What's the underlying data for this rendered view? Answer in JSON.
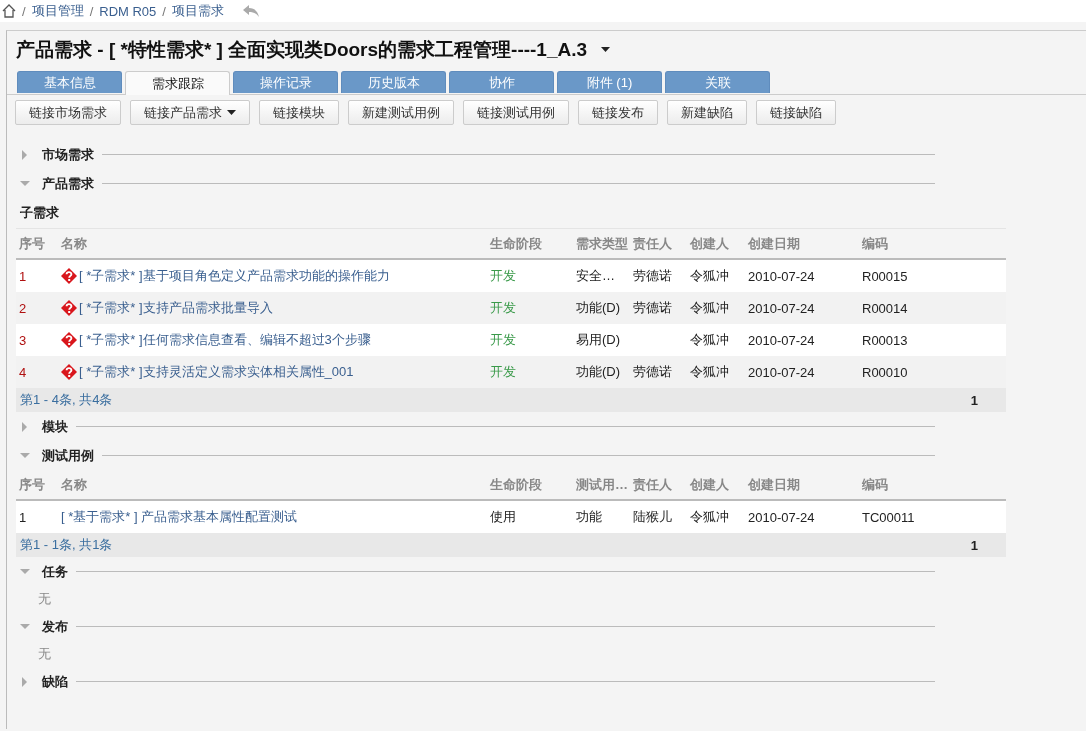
{
  "breadcrumb": {
    "separator": "/",
    "items": [
      "项目管理",
      "RDM R05",
      "项目需求"
    ]
  },
  "title": "产品需求 - [ *特性需求* ] 全面实现类Doors的需求工程管理----1_A.3",
  "tabs": [
    {
      "label": "基本信息",
      "selected": false
    },
    {
      "label": "需求跟踪",
      "selected": true
    },
    {
      "label": "操作记录",
      "selected": false
    },
    {
      "label": "历史版本",
      "selected": false
    },
    {
      "label": "协作",
      "selected": false
    },
    {
      "label": "附件 (1)",
      "selected": false
    },
    {
      "label": "关联",
      "selected": false
    }
  ],
  "buttons": [
    {
      "label": "链接市场需求",
      "kind": "plain"
    },
    {
      "label": "链接产品需求",
      "kind": "dropdown"
    },
    {
      "label": "链接模块",
      "kind": "plain"
    },
    {
      "label": "新建测试用例",
      "kind": "plain"
    },
    {
      "label": "链接测试用例",
      "kind": "plain"
    },
    {
      "label": "链接发布",
      "kind": "plain"
    },
    {
      "label": "新建缺陷",
      "kind": "plain"
    },
    {
      "label": "链接缺陷",
      "kind": "plain"
    }
  ],
  "sections": [
    {
      "title": "市场需求",
      "expanded": false
    },
    {
      "title": "产品需求",
      "expanded": true,
      "subtitle": "子需求",
      "table": {
        "columns": [
          "序号",
          "名称",
          "生命阶段",
          "需求类型",
          "责任人",
          "创建人",
          "创建日期",
          "编码"
        ],
        "rows": [
          {
            "kind": "requirement",
            "color": "#3a9a4a",
            "cells": [
              "1",
              "[ *子需求* ]基于项目角色定义产品需求功能的操作能力",
              "开发",
              "安全…",
              "劳德诺",
              "令狐冲",
              "2010-07-24",
              "R00015"
            ]
          },
          {
            "kind": "requirement",
            "color": "#3a9a4a",
            "cells": [
              "2",
              "[ *子需求* ]支持产品需求批量导入",
              "开发",
              "功能(D)",
              "劳德诺",
              "令狐冲",
              "2010-07-24",
              "R00014"
            ]
          },
          {
            "kind": "requirement",
            "color": "#3a9a4a",
            "cells": [
              "3",
              "[ *子需求* ]任何需求信息查看、编辑不超过3个步骤",
              "开发",
              "易用(D)",
              "",
              "令狐冲",
              "2010-07-24",
              "R00013"
            ]
          },
          {
            "kind": "requirement",
            "color": "#3a9a4a",
            "cells": [
              "4",
              "[ *子需求* ]支持灵活定义需求实体相关属性_001",
              "开发",
              "功能(D)",
              "劳德诺",
              "令狐冲",
              "2010-07-24",
              "R00010"
            ]
          }
        ],
        "pager": "第1 - 4条, 共4条",
        "page": "1"
      }
    },
    {
      "title": "模块",
      "expanded": false
    },
    {
      "title": "测试用例",
      "expanded": true,
      "table": {
        "columns": [
          "序号",
          "名称",
          "生命阶段",
          "测试用…",
          "责任人",
          "创建人",
          "创建日期",
          "编码"
        ],
        "rows": [
          {
            "kind": "testcase",
            "color": "#222222",
            "cells": [
              "1",
              "[ *基于需求* ] 产品需求基本属性配置测试",
              "使用",
              "功能",
              "陆猴儿",
              "令狐冲",
              "2010-07-24",
              "TC00011"
            ]
          }
        ],
        "pager": "第1 - 1条, 共1条",
        "page": "1"
      }
    },
    {
      "title": "任务",
      "expanded": true,
      "empty": "无"
    },
    {
      "title": "发布",
      "expanded": true,
      "empty": "无"
    },
    {
      "title": "缺陷",
      "expanded": false
    }
  ]
}
